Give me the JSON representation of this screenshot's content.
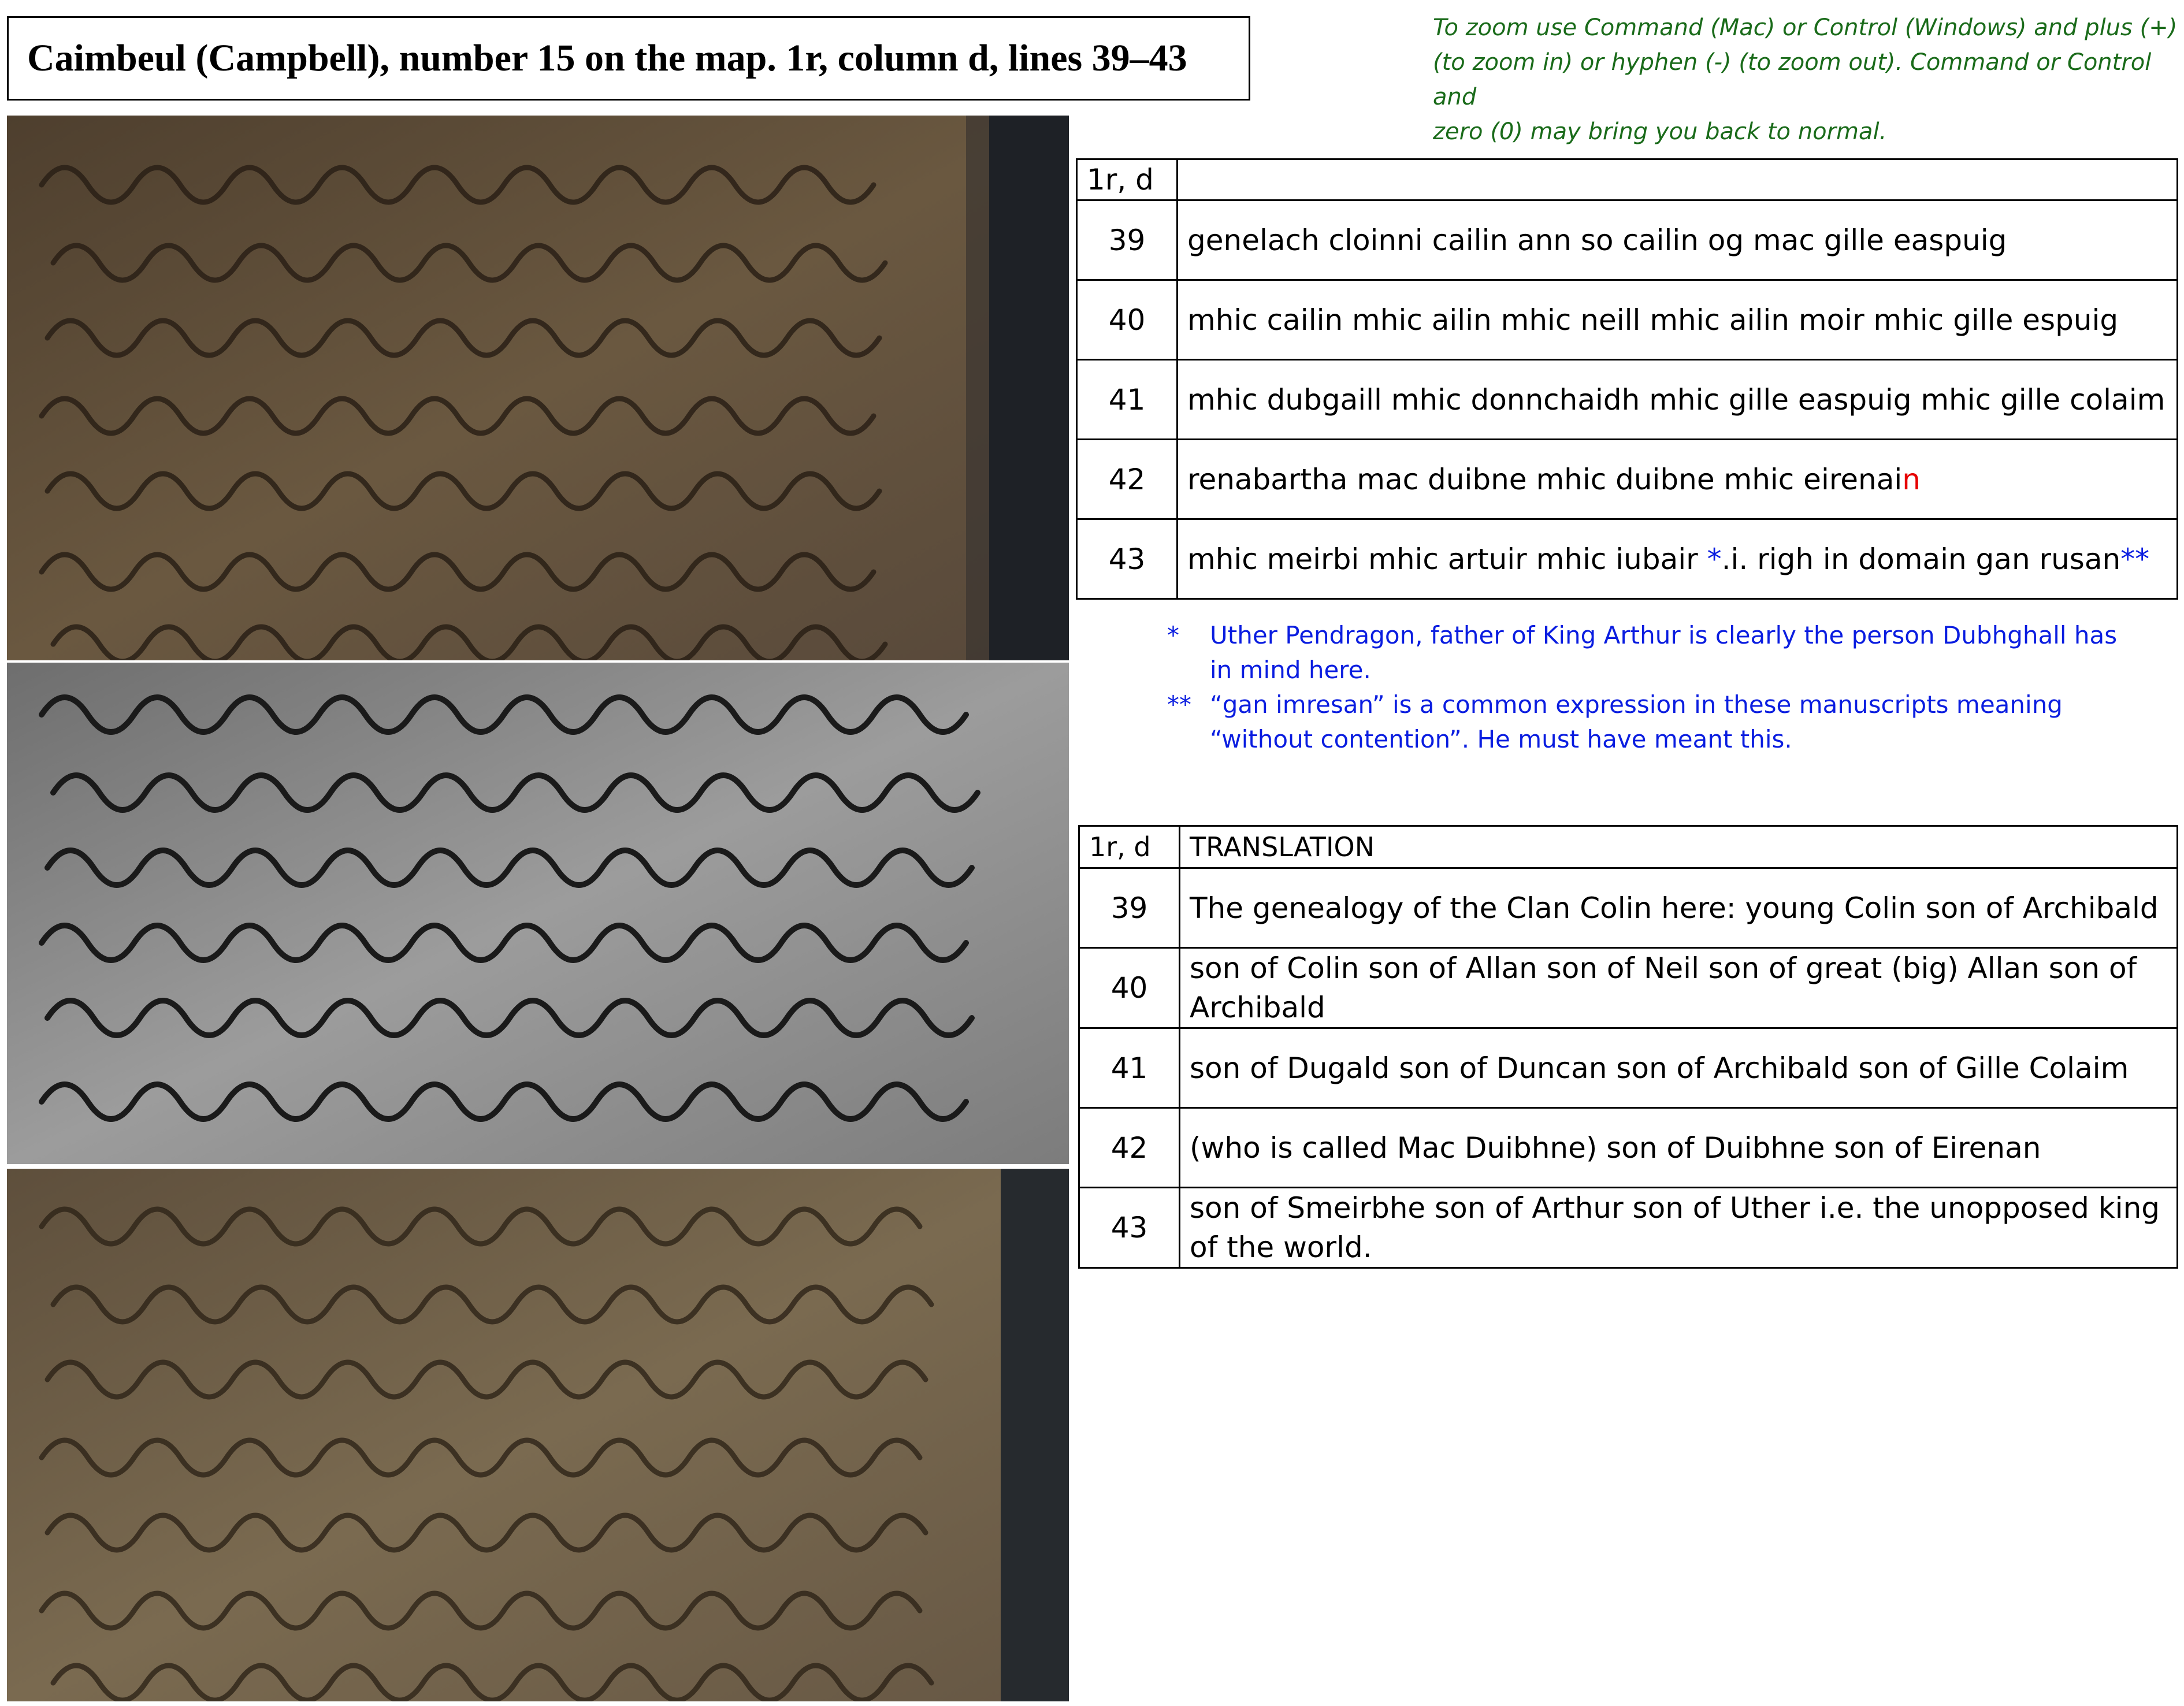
{
  "header": {
    "title": "Caimbeul (Campbell), number 15 on the map. 1r, column d, lines 39–43"
  },
  "zoom_help": {
    "line1": "To zoom use Command (Mac) or Control (Windows) and plus (+)",
    "line2": "(to zoom in) or hyphen (-) (to zoom out).  Command or Control and",
    "line3": "zero (0) may bring you back to normal."
  },
  "images": [
    {
      "name": "manuscript-photo-color",
      "tone": "#5a4a36"
    },
    {
      "name": "manuscript-photo-grayscale",
      "tone": "#8a8a8a"
    },
    {
      "name": "manuscript-photo-enhanced",
      "tone": "#6e5f48"
    }
  ],
  "transcription": {
    "header_ref": "1r, d",
    "header_text": "",
    "rows": [
      {
        "line": "39",
        "text": "genelach cloinni cailin ann so cailin og mac gille easpuig"
      },
      {
        "line": "40",
        "text": "mhic cailin mhic ailin mhic neill mhic ailin moir mhic gille espuig"
      },
      {
        "line": "41",
        "text": "mhic dubgaill mhic donnchaidh mhic gille easpuig mhic gille colaim"
      },
      {
        "line": "42",
        "text": "renabartha mac duibne mhic duibne mhic eirenai",
        "red_suffix": "n"
      },
      {
        "line": "43",
        "text": "mhic meirbi mhic artuir mhic iubair ",
        "mark1": "*",
        "middle": ".i. righ in domain gan rusan",
        "mark2": "**"
      }
    ]
  },
  "footnotes": [
    {
      "mark": "*",
      "text1": "Uther Pendragon, father of King Arthur is clearly the person Dubhghall has",
      "text2": "in mind here."
    },
    {
      "mark": "**",
      "text1": "“gan imresan” is a common expression in these manuscripts meaning",
      "text2": "“without contention”. He must have meant this."
    }
  ],
  "translation": {
    "header_ref": "1r, d",
    "header_text": "TRANSLATION",
    "rows": [
      {
        "line": "39",
        "text": "The genealogy of the Clan Colin here: young Colin son of Archibald"
      },
      {
        "line": "40",
        "text": "son of Colin son of Allan son of Neil son of great (big) Allan son of Archibald"
      },
      {
        "line": "41",
        "text": "son of Dugald son of Duncan son of Archibald son of Gille Colaim"
      },
      {
        "line": "42",
        "text": "(who is called Mac Duibhne) son of Duibhne son of Eirenan"
      },
      {
        "line": "43",
        "text": "son of Smeirbhe son of Arthur son of Uther i.e. the unopposed king of the world."
      }
    ]
  }
}
